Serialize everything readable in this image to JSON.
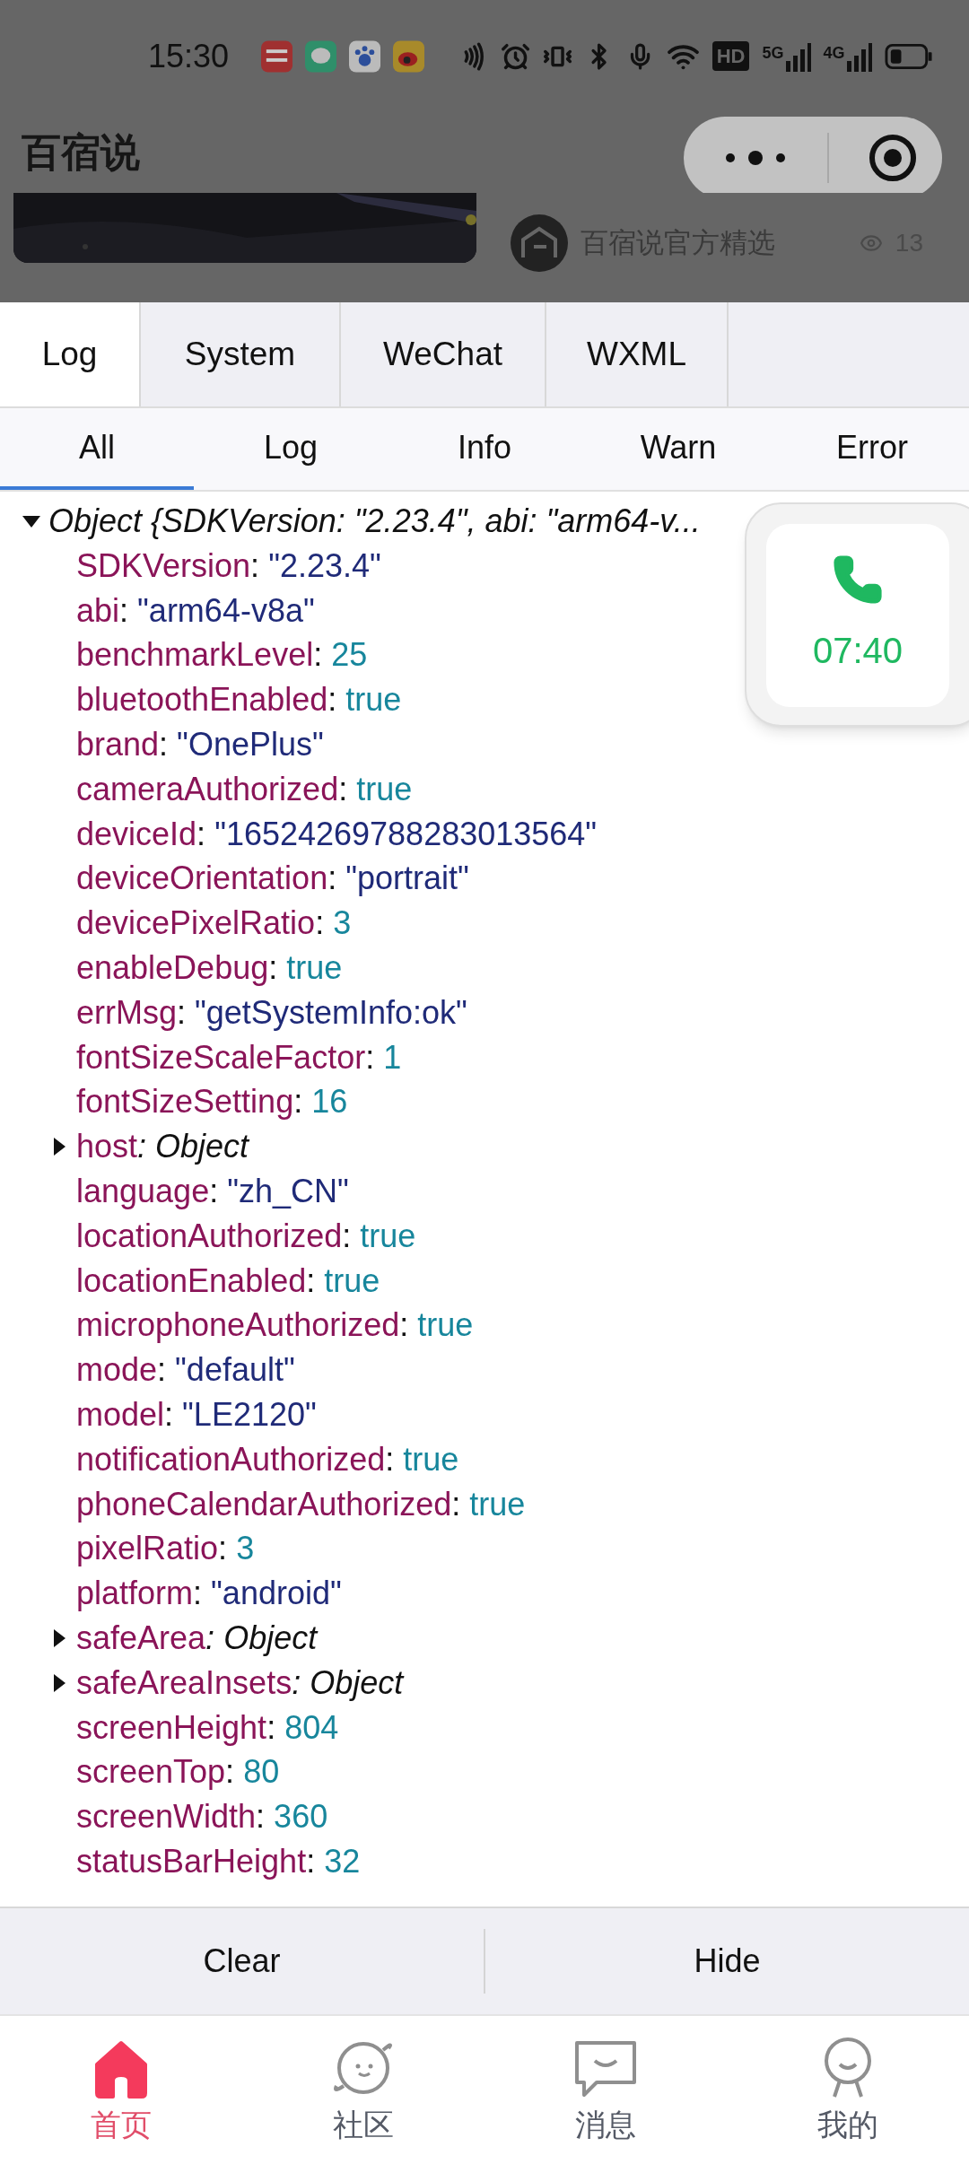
{
  "status_bar": {
    "time": "15:30",
    "hd_label": "HD",
    "networks": [
      "5G",
      "4G"
    ]
  },
  "header": {
    "title": "百宿说"
  },
  "background_feed": {
    "author": "百宿说官方精选",
    "views": "13"
  },
  "panel_tabs": [
    {
      "label": "Log",
      "selected": true
    },
    {
      "label": "System",
      "selected": false
    },
    {
      "label": "WeChat",
      "selected": false
    },
    {
      "label": "WXML",
      "selected": false
    }
  ],
  "filter_tabs": [
    {
      "label": "All",
      "selected": true
    },
    {
      "label": "Log",
      "selected": false
    },
    {
      "label": "Info",
      "selected": false
    },
    {
      "label": "Warn",
      "selected": false
    },
    {
      "label": "Error",
      "selected": false
    }
  ],
  "log_entry": {
    "summary": "Object {SDKVersion: \"2.23.4\", abi: \"arm64-v...",
    "expanded": true,
    "children": [
      {
        "key": "SDKVersion",
        "sep": ":",
        "value": "\"2.23.4\"",
        "kind": "string"
      },
      {
        "key": "abi",
        "sep": ":",
        "value": "\"arm64-v8a\"",
        "kind": "string"
      },
      {
        "key": "benchmarkLevel",
        "sep": ":",
        "value": "25",
        "kind": "number"
      },
      {
        "key": "bluetoothEnabled",
        "sep": ":",
        "value": "true",
        "kind": "boolean"
      },
      {
        "key": "brand",
        "sep": ":",
        "value": "\"OnePlus\"",
        "kind": "string"
      },
      {
        "key": "cameraAuthorized",
        "sep": ":",
        "value": "true",
        "kind": "boolean"
      },
      {
        "key": "deviceId",
        "sep": ":",
        "value": "\"16524269788283013564\"",
        "kind": "string"
      },
      {
        "key": "deviceOrientation",
        "sep": ":",
        "value": "\"portrait\"",
        "kind": "string"
      },
      {
        "key": "devicePixelRatio",
        "sep": ":",
        "value": "3",
        "kind": "number"
      },
      {
        "key": "enableDebug",
        "sep": ":",
        "value": "true",
        "kind": "boolean"
      },
      {
        "key": "errMsg",
        "sep": ":",
        "value": "\"getSystemInfo:ok\"",
        "kind": "string"
      },
      {
        "key": "fontSizeScaleFactor",
        "sep": ":",
        "value": "1",
        "kind": "number"
      },
      {
        "key": "fontSizeSetting",
        "sep": ":",
        "value": "16",
        "kind": "number"
      },
      {
        "key": "host",
        "sep": ":",
        "value": "Object",
        "kind": "object",
        "expanded": false
      },
      {
        "key": "language",
        "sep": ":",
        "value": "\"zh_CN\"",
        "kind": "string"
      },
      {
        "key": "locationAuthorized",
        "sep": ":",
        "value": "true",
        "kind": "boolean"
      },
      {
        "key": "locationEnabled",
        "sep": ":",
        "value": "true",
        "kind": "boolean"
      },
      {
        "key": "microphoneAuthorized",
        "sep": ":",
        "value": "true",
        "kind": "boolean"
      },
      {
        "key": "mode",
        "sep": ":",
        "value": "\"default\"",
        "kind": "string"
      },
      {
        "key": "model",
        "sep": ":",
        "value": "\"LE2120\"",
        "kind": "string"
      },
      {
        "key": "notificationAuthorized",
        "sep": ":",
        "value": "true",
        "kind": "boolean"
      },
      {
        "key": "phoneCalendarAuthorized",
        "sep": ":",
        "value": "true",
        "kind": "boolean"
      },
      {
        "key": "pixelRatio",
        "sep": ":",
        "value": "3",
        "kind": "number"
      },
      {
        "key": "platform",
        "sep": ":",
        "value": "\"android\"",
        "kind": "string"
      },
      {
        "key": "safeArea",
        "sep": ":",
        "value": "Object",
        "kind": "object",
        "expanded": false
      },
      {
        "key": "safeAreaInsets",
        "sep": ":",
        "value": "Object",
        "kind": "object",
        "expanded": false
      },
      {
        "key": "screenHeight",
        "sep": ":",
        "value": "804",
        "kind": "number"
      },
      {
        "key": "screenTop",
        "sep": ":",
        "value": "80",
        "kind": "number"
      },
      {
        "key": "screenWidth",
        "sep": ":",
        "value": "360",
        "kind": "number"
      },
      {
        "key": "statusBarHeight",
        "sep": ":",
        "value": "32",
        "kind": "number"
      }
    ]
  },
  "call_widget": {
    "duration": "07:40"
  },
  "actions": [
    "Clear",
    "Hide"
  ],
  "bottom_nav": [
    {
      "label": "首页",
      "selected": true
    },
    {
      "label": "社区",
      "selected": false
    },
    {
      "label": "消息",
      "selected": false
    },
    {
      "label": "我的",
      "selected": false
    }
  ]
}
